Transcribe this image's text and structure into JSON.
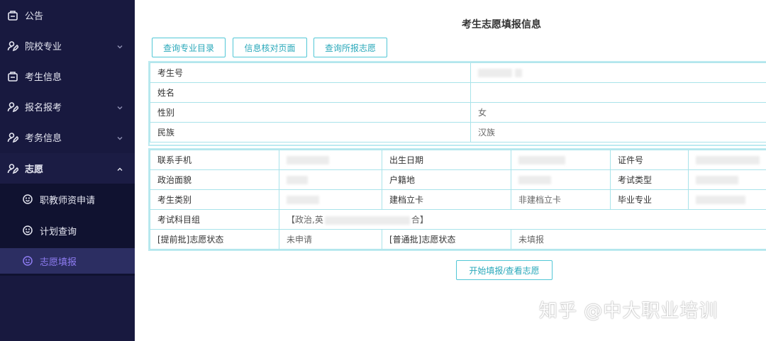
{
  "sidebar": {
    "items": [
      {
        "label": "公告",
        "icon": "bulletin-icon"
      },
      {
        "label": "院校专业",
        "icon": "user-edit-icon"
      },
      {
        "label": "考生信息",
        "icon": "id-card-icon"
      },
      {
        "label": "报名报考",
        "icon": "user-edit-icon"
      },
      {
        "label": "考务信息",
        "icon": "user-edit-icon"
      },
      {
        "label": "志愿",
        "icon": "user-edit-icon"
      }
    ],
    "submenu": [
      {
        "label": "职教师资申请",
        "icon": "smile-circle-icon"
      },
      {
        "label": "计划查询",
        "icon": "smile-circle-icon"
      },
      {
        "label": "志愿填报",
        "icon": "smile-circle-icon"
      }
    ]
  },
  "main": {
    "title": "考生志愿填报信息",
    "buttons": [
      "查询专业目录",
      "信息核对页面",
      "查询所报志愿"
    ],
    "basic": {
      "rows": [
        {
          "label": "考生号",
          "value": ""
        },
        {
          "label": "姓名",
          "value": ""
        },
        {
          "label": "性别",
          "value": "女"
        },
        {
          "label": "民族",
          "value": "汉族"
        }
      ]
    },
    "detail": {
      "r1": {
        "l1": "联系手机",
        "v1": "",
        "l2": "出生日期",
        "v2": "",
        "l3": "证件号",
        "v3": ""
      },
      "r2": {
        "l1": "政治面貌",
        "v1": "",
        "l2": "户籍地",
        "v2": "",
        "l3": "考试类型",
        "v3": ""
      },
      "r3": {
        "l1": "考生类别",
        "v1": "",
        "l2": "建档立卡",
        "v2": "非建档立卡",
        "l3": "毕业专业",
        "v3": ""
      },
      "r4": {
        "l1": "考试科目组",
        "v1a": "【政治,英",
        "v1b": "合】"
      },
      "r5": {
        "l1": "[提前批]志愿状态",
        "v1": "未申请",
        "l2": "[普通批]志愿状态",
        "v2": "未填报"
      }
    },
    "start_button": "开始填报/查看志愿"
  },
  "watermark": "知乎 @中大职业培训",
  "colors": {
    "sidebar_bg": "#18193f",
    "active_bg": "#2c2e62",
    "active_text": "#8e7cf2",
    "accent": "#29a8ba",
    "border": "#a9e3ea"
  }
}
